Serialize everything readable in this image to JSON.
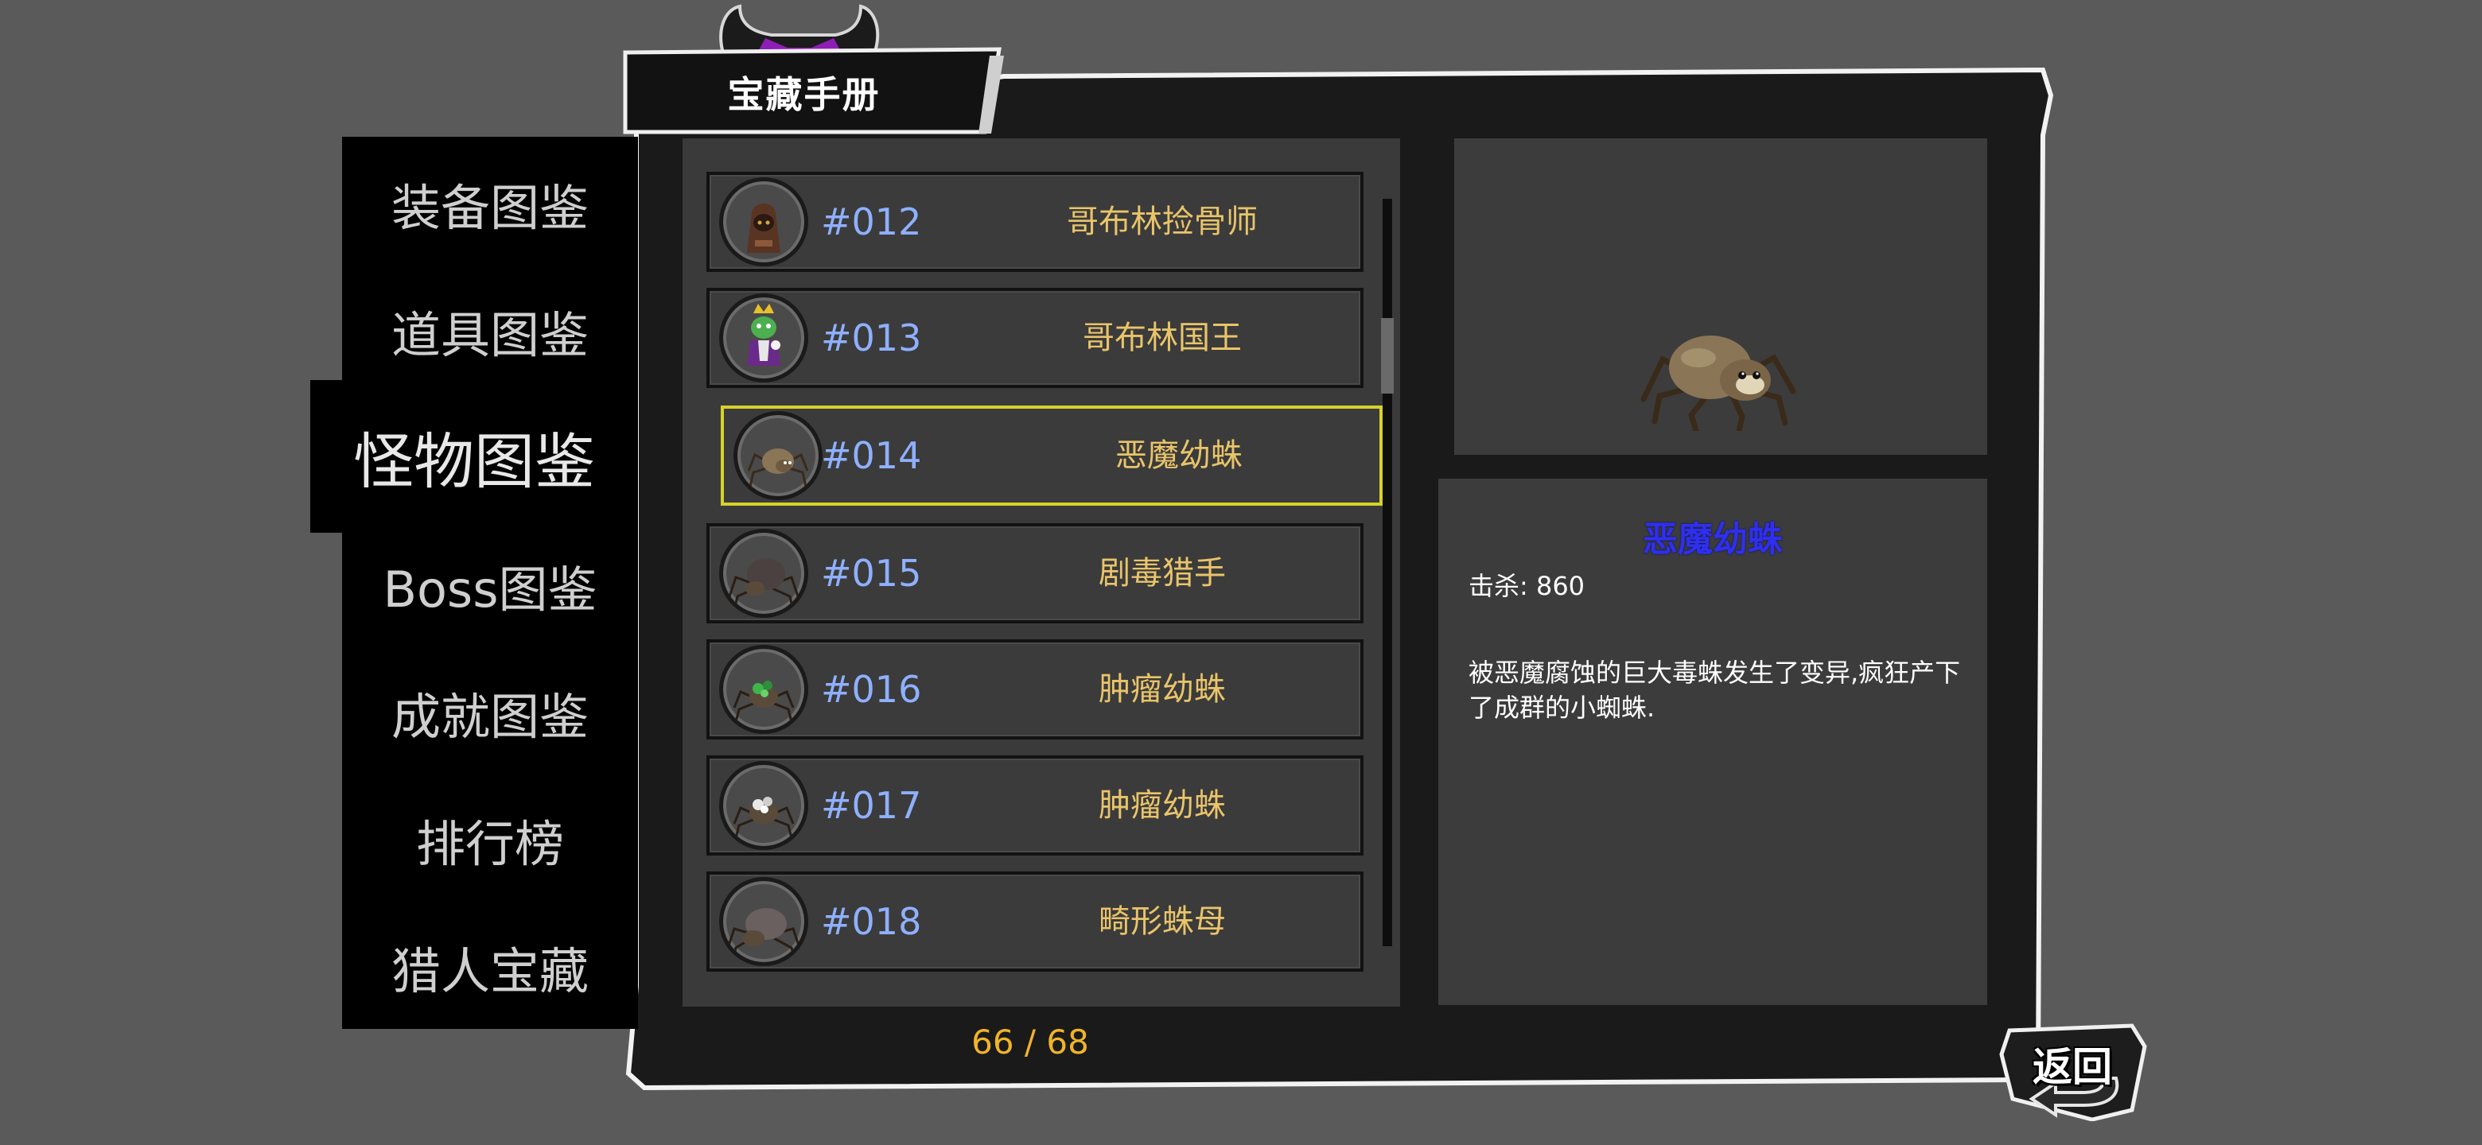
{
  "window": {
    "title": "宝藏手册"
  },
  "side_nav": {
    "items": [
      {
        "label": "装备图鉴",
        "active": false
      },
      {
        "label": "道具图鉴",
        "active": false
      },
      {
        "label": "怪物图鉴",
        "active": true
      },
      {
        "label": "Boss图鉴",
        "active": false
      },
      {
        "label": "成就图鉴",
        "active": false
      },
      {
        "label": "排行榜",
        "active": false
      },
      {
        "label": "猎人宝藏",
        "active": false
      }
    ]
  },
  "monster_list": {
    "rows": [
      {
        "number": "#012",
        "name": "哥布林捡骨师",
        "portrait": "hooded-goblin-icon"
      },
      {
        "number": "#013",
        "name": "哥布林国王",
        "portrait": "goblin-king-icon"
      },
      {
        "number": "#014",
        "name": "恶魔幼蛛",
        "portrait": "demon-spiderling-icon",
        "selected": true
      },
      {
        "number": "#015",
        "name": "剧毒猎手",
        "portrait": "venom-hunter-spider-icon"
      },
      {
        "number": "#016",
        "name": "肿瘤幼蛛",
        "portrait": "tumor-spiderling-green-icon"
      },
      {
        "number": "#017",
        "name": "肿瘤幼蛛",
        "portrait": "tumor-spiderling-white-icon"
      },
      {
        "number": "#018",
        "name": "畸形蛛母",
        "portrait": "deformed-spider-mother-icon"
      }
    ],
    "counter": "66 / 68"
  },
  "detail": {
    "name": "恶魔幼蛛",
    "kills": "击杀: 860",
    "description": "被恶魔腐蚀的巨大毒蛛发生了变异,疯狂产下了成群的小蜘蛛.",
    "image_icon": "demon-spiderling-icon"
  },
  "back_button": {
    "label": "返回"
  },
  "colors": {
    "background": "#5a5a5a",
    "panel": "#3a3a3a",
    "number_text": "#8fb0ff",
    "name_text": "#e9c46a",
    "selected_border": "#d7d22a",
    "detail_name": "#2f2ff0",
    "counter": "#f0b429"
  }
}
